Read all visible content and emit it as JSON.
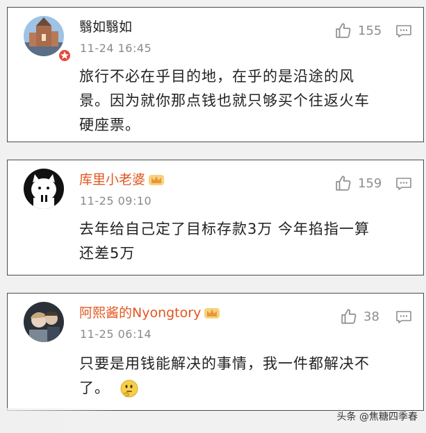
{
  "comments": [
    {
      "name": "翳如翳如",
      "time": "11-24 16:45",
      "likes": "155",
      "text_lines": [
        "旅行不必在乎目的地，在乎的是沿途的风",
        "景。因为就你那点钱也就只够买个往返火车",
        "硬座票。"
      ]
    },
    {
      "name": "库里小老婆",
      "time": "11-25 09:10",
      "likes": "159",
      "text_lines": [
        "去年给自己定了目标存款3万  今年掐指一算",
        "还差5万"
      ]
    },
    {
      "name": "阿熙酱的Nyongtory",
      "time": "11-25 06:14",
      "likes": "38",
      "text_lines": [
        "只要是用钱能解决的事情，我一件都解决不",
        "了。"
      ]
    }
  ],
  "watermark": "头条 @焦糖四季春",
  "colors": {
    "vip_name": "#e2561f",
    "meta_gray": "#8a8a8a",
    "border": "#4a4a4a"
  },
  "icons": [
    "thumbs-up-icon",
    "comment-icon",
    "crown-icon",
    "thinking-emoji-icon"
  ]
}
